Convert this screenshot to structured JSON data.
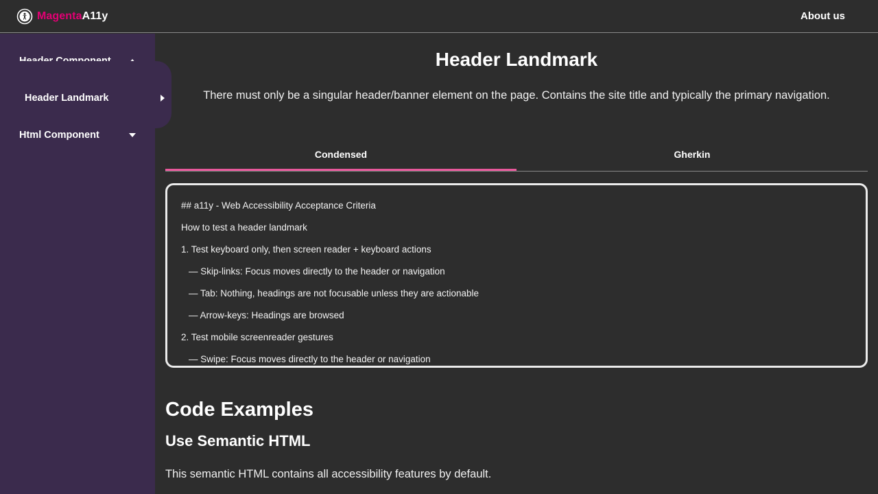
{
  "header": {
    "logo_part1": "Magenta",
    "logo_part2": "A11y",
    "about_label": "About us"
  },
  "sidebar": {
    "group1_label": "Header Component",
    "group1_sub_label": "Header Landmark",
    "group2_label": "Html Component"
  },
  "main": {
    "title": "Header Landmark",
    "description": "There must only be a singular header/banner element on the page. Contains the site title and typically the primary navigation.",
    "tabs": [
      {
        "label": "Condensed",
        "active": true
      },
      {
        "label": "Gherkin",
        "active": false
      }
    ],
    "criteria": [
      "## a11y - Web Accessibility Acceptance Criteria",
      "How to test a header landmark",
      "1. Test keyboard only, then screen reader + keyboard actions",
      "— Skip-links: Focus moves directly to the header or navigation",
      "— Tab: Nothing, headings are not focusable unless they are actionable",
      "— Arrow-keys: Headings are browsed",
      "2. Test mobile screenreader gestures",
      "— Swipe: Focus moves directly to the header or navigation"
    ],
    "code_examples_heading": "Code Examples",
    "semantic_heading": "Use Semantic HTML",
    "semantic_text": "This semantic HTML contains all accessibility features by default."
  },
  "colors": {
    "accent": "#e20074",
    "tab_underline": "#e8589b",
    "sidebar_bg": "#3b2b4d",
    "page_bg": "#2d2d2d"
  },
  "icons": {
    "logo": "accessibility-person-icon",
    "group1": "caret-up-icon",
    "sub_item": "caret-right-icon",
    "group2": "caret-down-icon"
  }
}
